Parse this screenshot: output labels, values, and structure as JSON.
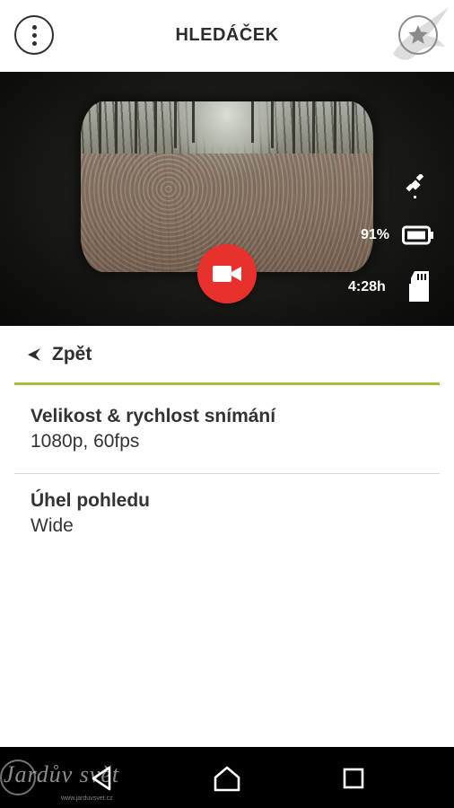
{
  "header": {
    "title": "HLEDÁČEK",
    "menu_icon": "more-vertical-icon",
    "favorite_icon": "star-icon"
  },
  "viewfinder": {
    "gps_icon": "satellite-icon",
    "battery": {
      "percent_label": "91%",
      "level": 0.91,
      "icon": "battery-icon"
    },
    "remaining": {
      "label": "4:28h",
      "icon": "sd-card-icon"
    },
    "record_icon": "video-camera-icon",
    "record_color": "#e8312d"
  },
  "panel": {
    "back_label": "Zpět",
    "accent_color": "#a6c23a",
    "settings": [
      {
        "name": "Velikost & rychlost snímání",
        "value": "1080p, 60fps"
      },
      {
        "name": "Úhel pohledu",
        "value": "Wide"
      }
    ]
  },
  "navbar": {
    "back_icon": "triangle-back-icon",
    "home_icon": "home-icon",
    "recents_icon": "square-recents-icon"
  },
  "watermark": {
    "text": "Jardův svět",
    "url": "www.jarduvsvet.cz"
  }
}
